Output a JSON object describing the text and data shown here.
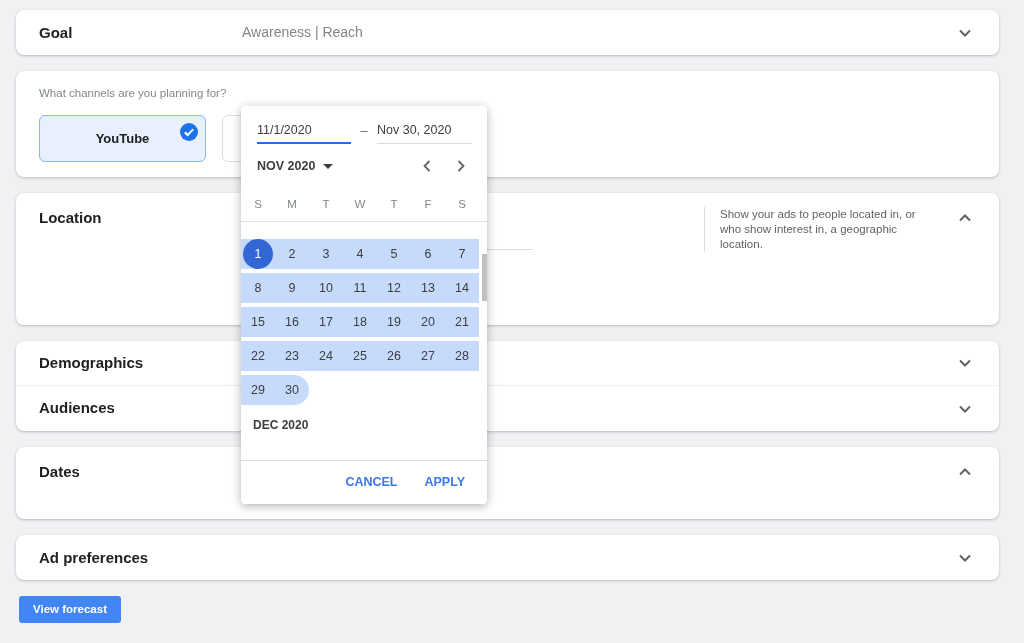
{
  "sections": [
    {
      "kind": "summary",
      "title": "Goal",
      "value": "Awareness | Reach",
      "expanded": false
    },
    {
      "kind": "channels",
      "prompt": "What channels are you planning for?",
      "channels": [
        {
          "label": "YouTube",
          "selected": true
        },
        {
          "selected": false
        }
      ]
    },
    {
      "kind": "location",
      "title": "Location",
      "help": "Show your ads to people located in, or who show interest in, a geographic location.",
      "expanded": true
    },
    {
      "kind": "group",
      "rows": [
        {
          "title": "Demographics",
          "expanded": false
        },
        {
          "title": "Audiences",
          "expanded": false
        }
      ]
    },
    {
      "kind": "detail",
      "title": "Dates",
      "expanded": true
    },
    {
      "kind": "summary",
      "title": "Ad preferences",
      "expanded": false
    }
  ],
  "forecast_button": {
    "label": "View forecast"
  },
  "date_picker": {
    "start_field": {
      "value": "11/1/2020",
      "focused": true
    },
    "separator": "–",
    "end_field": {
      "value": "Nov 30, 2020",
      "focused": false
    },
    "month_menu": "NOV 2020",
    "weekdays": [
      "S",
      "M",
      "T",
      "W",
      "T",
      "F",
      "S"
    ],
    "weeks": [
      [
        {
          "day": "1",
          "in_range": true,
          "selected": true
        },
        {
          "day": "2",
          "in_range": true,
          "selected": false
        },
        {
          "day": "3",
          "in_range": true,
          "selected": false
        },
        {
          "day": "4",
          "in_range": true,
          "selected": false
        },
        {
          "day": "5",
          "in_range": true,
          "selected": false
        },
        {
          "day": "6",
          "in_range": true,
          "selected": false
        },
        {
          "day": "7",
          "in_range": true,
          "selected": false
        }
      ],
      [
        {
          "day": "8",
          "in_range": true,
          "selected": false
        },
        {
          "day": "9",
          "in_range": true,
          "selected": false
        },
        {
          "day": "10",
          "in_range": true,
          "selected": false
        },
        {
          "day": "11",
          "in_range": true,
          "selected": false
        },
        {
          "day": "12",
          "in_range": true,
          "selected": false
        },
        {
          "day": "13",
          "in_range": true,
          "selected": false
        },
        {
          "day": "14",
          "in_range": true,
          "selected": false
        }
      ],
      [
        {
          "day": "15",
          "in_range": true,
          "selected": false
        },
        {
          "day": "16",
          "in_range": true,
          "selected": false
        },
        {
          "day": "17",
          "in_range": true,
          "selected": false
        },
        {
          "day": "18",
          "in_range": true,
          "selected": false
        },
        {
          "day": "19",
          "in_range": true,
          "selected": false
        },
        {
          "day": "20",
          "in_range": true,
          "selected": false
        },
        {
          "day": "21",
          "in_range": true,
          "selected": false
        }
      ],
      [
        {
          "day": "22",
          "in_range": true,
          "selected": false
        },
        {
          "day": "23",
          "in_range": true,
          "selected": false
        },
        {
          "day": "24",
          "in_range": true,
          "selected": false
        },
        {
          "day": "25",
          "in_range": true,
          "selected": false
        },
        {
          "day": "26",
          "in_range": true,
          "selected": false
        },
        {
          "day": "27",
          "in_range": true,
          "selected": false
        },
        {
          "day": "28",
          "in_range": true,
          "selected": false
        }
      ],
      [
        {
          "day": "29",
          "in_range": true,
          "selected": false
        },
        {
          "day": "30",
          "in_range": true,
          "selected": false
        }
      ]
    ],
    "next_month": "DEC 2020",
    "buttons": [
      "CANCEL",
      "APPLY"
    ]
  }
}
